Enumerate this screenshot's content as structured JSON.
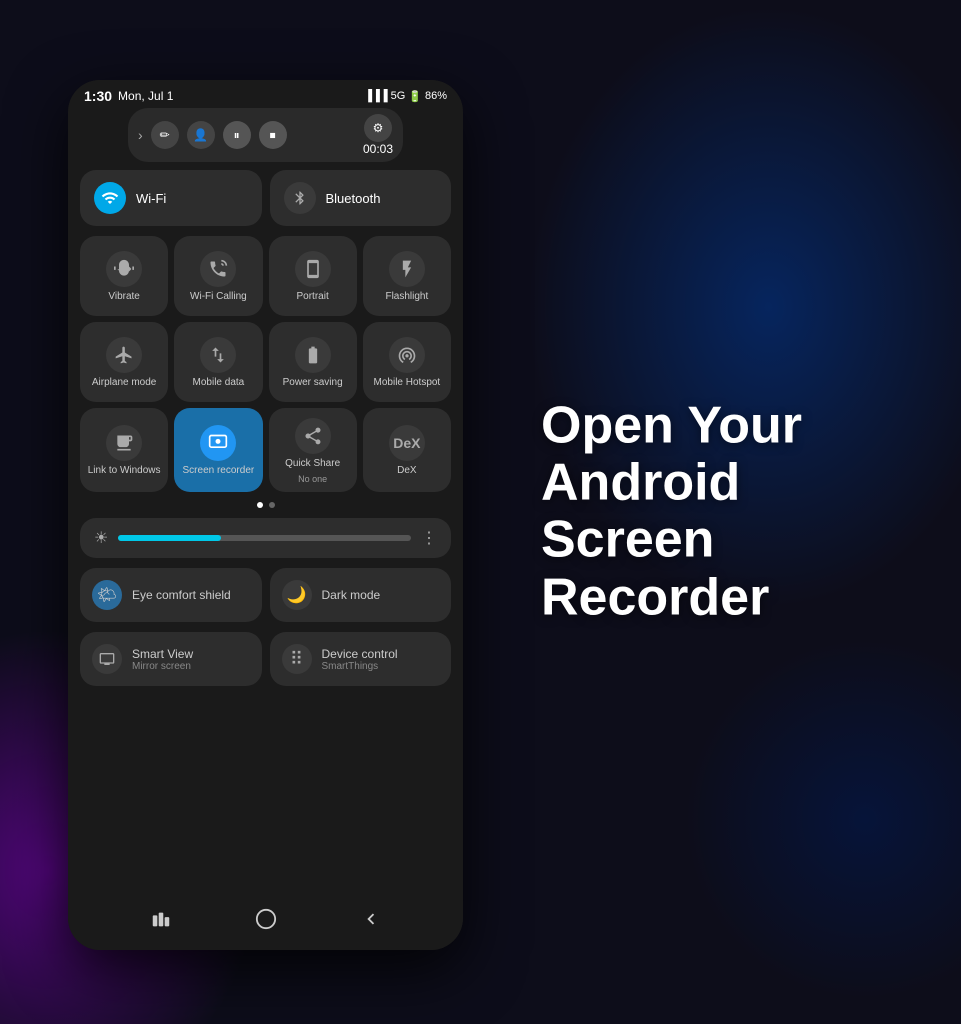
{
  "background": {
    "color": "#0d0d1a"
  },
  "promo": {
    "line1": "Open Your",
    "line2": "Android",
    "line3": "Screen",
    "line4": "Recorder"
  },
  "status_bar": {
    "time": "1:30",
    "date": "Mon, Jul 1",
    "signal": "5G",
    "battery": "86%"
  },
  "recorder_bar": {
    "timer": "00:03",
    "chevron_label": "›",
    "edit_icon": "✏",
    "camera_icon": "👤",
    "pause_icon": "⏸",
    "stop_icon": "⏹",
    "settings_icon": "⚙"
  },
  "quick_settings": {
    "wifi": {
      "label": "Wi-Fi",
      "active": true
    },
    "bluetooth": {
      "label": "Bluetooth",
      "active": false
    },
    "tiles": [
      {
        "icon": "🔔",
        "label": "Vibrate",
        "active": false
      },
      {
        "icon": "📶",
        "label": "Wi-Fi Calling",
        "active": false
      },
      {
        "icon": "🖼",
        "label": "Portrait",
        "active": false
      },
      {
        "icon": "🔦",
        "label": "Flashlight",
        "active": false
      },
      {
        "icon": "✈",
        "label": "Airplane mode",
        "active": false
      },
      {
        "icon": "↕",
        "label": "Mobile data",
        "active": false
      },
      {
        "icon": "🔋",
        "label": "Power saving",
        "active": false
      },
      {
        "icon": "📡",
        "label": "Mobile Hotspot",
        "active": false
      },
      {
        "icon": "🖥",
        "label": "Link to Windows",
        "active": false
      },
      {
        "icon": "⏺",
        "label": "Screen recorder",
        "active": true
      },
      {
        "icon": "🔄",
        "label": "Quick Share\nNo one",
        "sublabel": "No one",
        "active": false
      },
      {
        "icon": "D",
        "label": "DeX",
        "active": false
      }
    ]
  },
  "brightness": {
    "fill_percent": 35
  },
  "comfort_tiles": [
    {
      "label": "Eye comfort shield",
      "icon": "🌤",
      "type": "eye"
    },
    {
      "label": "Dark mode",
      "icon": "🌙",
      "type": "dark"
    }
  ],
  "bottom_tiles": [
    {
      "label": "Smart View",
      "sublabel": "Mirror screen",
      "icon": "📺"
    },
    {
      "label": "Device control",
      "sublabel": "SmartThings",
      "icon": "⠿"
    }
  ],
  "navigation": {
    "recent_icon": "|||",
    "home_icon": "○",
    "back_icon": "<"
  }
}
